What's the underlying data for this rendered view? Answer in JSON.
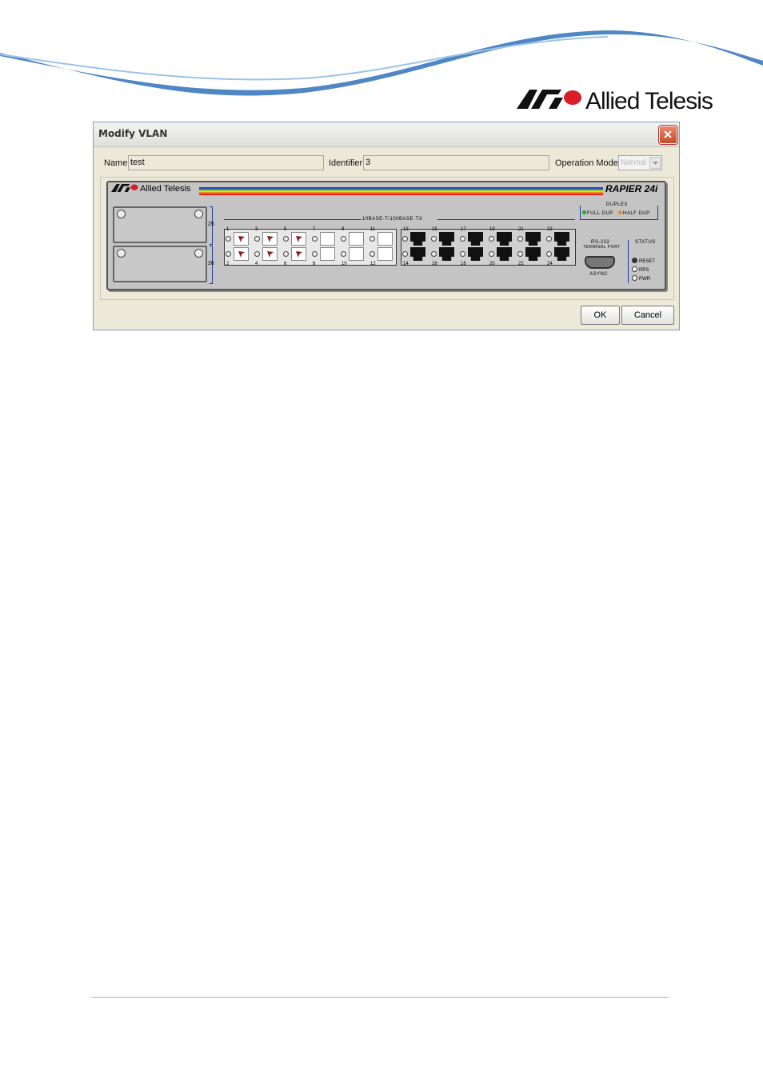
{
  "brand": {
    "name": "Allied Telesis"
  },
  "dialog": {
    "title": "Modify VLAN",
    "fields": {
      "name_label": "Name",
      "name_value": "test",
      "identifier_label": "Identifier",
      "identifier_value": "3",
      "operation_mode_label": "Operation Mode",
      "operation_mode_value": "Normal"
    },
    "device": {
      "logo": "Allied Telesis",
      "model": "RAPIER 24i",
      "section_label": "10BASE-T/100BASE-TX",
      "slot_numbers": [
        "25",
        "26"
      ],
      "port_numbers_top": [
        "1",
        "3",
        "5",
        "7",
        "9",
        "11",
        "13",
        "15",
        "17",
        "19",
        "21",
        "23"
      ],
      "port_numbers_bottom": [
        "2",
        "4",
        "6",
        "8",
        "10",
        "12",
        "14",
        "16",
        "18",
        "20",
        "22",
        "24"
      ],
      "vlan_member_ports": [
        "1",
        "2",
        "3",
        "4",
        "5",
        "6"
      ],
      "duplex": {
        "title": "DUPLEX",
        "full": "FULL DUP",
        "half": "HALF DUP",
        "full_color": "#22aa22",
        "half_color": "#ee8822"
      },
      "rs232": {
        "title": "RS-232",
        "subtitle": "TERMINAL PORT",
        "label": "ASYNC"
      },
      "status": {
        "title": "STATUS",
        "items": [
          "RESET",
          "RPS",
          "PWR"
        ]
      }
    },
    "buttons": {
      "ok": "OK",
      "cancel": "Cancel"
    }
  }
}
